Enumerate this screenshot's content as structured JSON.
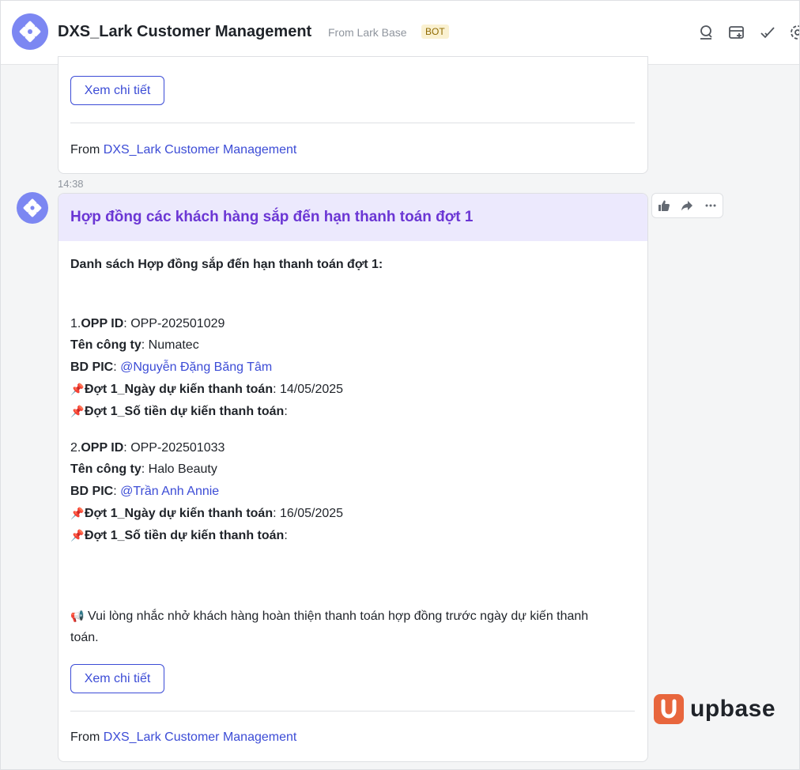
{
  "header": {
    "title": "DXS_Lark Customer Management",
    "subtitle": "From Lark Base",
    "badge": "BOT",
    "icons": [
      "search-chat-icon",
      "add-tab-icon",
      "tasks-check-icon",
      "settings-icon"
    ]
  },
  "previous_card": {
    "detail_button": "Xem chi tiết",
    "from_prefix": "From ",
    "from_link": "DXS_Lark Customer Management"
  },
  "message": {
    "time": "14:38",
    "card_title": "Hợp đồng các khách hàng sắp đến hạn thanh toán đợt 1",
    "intro": "Danh sách Hợp đồng sắp đến hạn thanh toán đợt 1:",
    "items": [
      {
        "index": "1.",
        "opp_label": "OPP ID",
        "opp_value": ": OPP-202501029",
        "company_label": "Tên công ty",
        "company_value": ": Numatec",
        "pic_label": "BD PIC",
        "pic_sep": ": ",
        "pic_value": "@Nguyễn Đặng Băng Tâm",
        "date_label": "Đợt 1_Ngày dự kiến thanh toán",
        "date_value": ": 14/05/2025",
        "amount_label": "Đợt 1_Số tiền dự kiến thanh toán",
        "amount_value": ":"
      },
      {
        "index": "2.",
        "opp_label": "OPP ID",
        "opp_value": ": OPP-202501033",
        "company_label": "Tên công ty",
        "company_value": ": Halo Beauty",
        "pic_label": "BD PIC",
        "pic_sep": ": ",
        "pic_value": "@Trần Anh Annie",
        "date_label": "Đợt 1_Ngày dự kiến thanh toán",
        "date_value": ": 16/05/2025",
        "amount_label": "Đợt 1_Số tiền dự kiến thanh toán",
        "amount_value": ":"
      }
    ],
    "reminder_line1": "Vui lòng nhắc nhở khách hàng hoàn thiện thanh toán hợp đồng trước ngày dự kiến thanh",
    "reminder_line2": "toán.",
    "detail_button": "Xem chi tiết",
    "from_prefix": "From ",
    "from_link": "DXS_Lark Customer Management"
  },
  "watermark": {
    "brand": "upbase"
  },
  "colors": {
    "accent": "#3c4cd6",
    "card_header_bg": "#ece9fd",
    "card_title": "#6b36d4",
    "avatar": "#7c87f2",
    "brand_orange": "#e8663d"
  }
}
